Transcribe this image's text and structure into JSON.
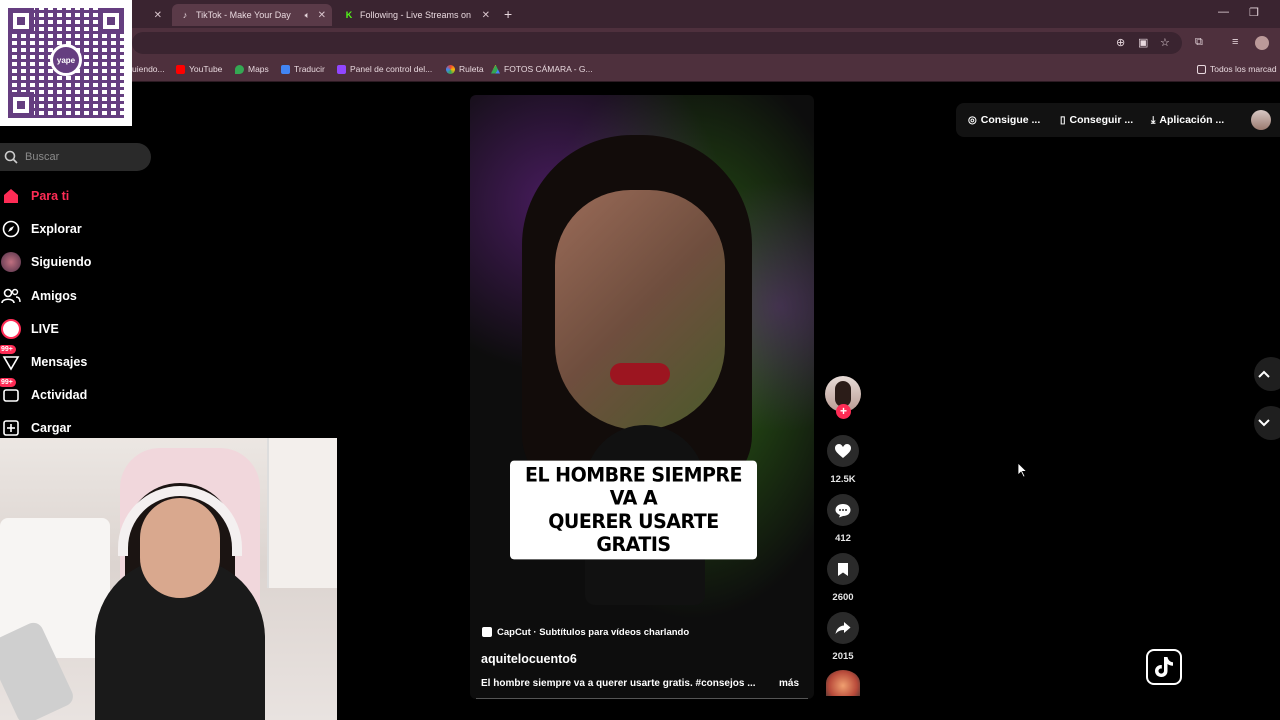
{
  "browser": {
    "tabs": [
      {
        "title": "TikTok - Make Your Day",
        "active": true,
        "icon": "tiktok-icon"
      },
      {
        "title": "Following - Live Streams on Kic",
        "active": false,
        "icon": "kick-icon"
      }
    ],
    "bookmarks": [
      {
        "label": "uiendo...",
        "color": "#888888"
      },
      {
        "label": "YouTube",
        "color": "#ff0000"
      },
      {
        "label": "Maps",
        "color": "#34a853"
      },
      {
        "label": "Traducir",
        "color": "#4285f4"
      },
      {
        "label": "Panel de control del...",
        "color": "#9146ff"
      },
      {
        "label": "Ruleta",
        "color": "#ea4335"
      },
      {
        "label": "FOTOS CÁMARA - G...",
        "color": "#fbbc04"
      }
    ],
    "all_bookmarks": "Todos los marcad"
  },
  "overlay": {
    "qr_brand": "yape"
  },
  "sidebar": {
    "search_placeholder": "Buscar",
    "items": [
      {
        "label": "Para ti",
        "icon": "home-icon",
        "active": true
      },
      {
        "label": "Explorar",
        "icon": "compass-icon"
      },
      {
        "label": "Siguiendo",
        "icon": "following-avatar-icon"
      },
      {
        "label": "Amigos",
        "icon": "friends-icon"
      },
      {
        "label": "LIVE",
        "icon": "live-icon"
      },
      {
        "label": "Mensajes",
        "icon": "messages-icon",
        "badge": "99+"
      },
      {
        "label": "Actividad",
        "icon": "activity-icon",
        "badge": "99+"
      },
      {
        "label": "Cargar",
        "icon": "upload-icon"
      }
    ]
  },
  "topbar": {
    "buttons": [
      "Consigue ...",
      "Conseguir ...",
      "Aplicación ..."
    ]
  },
  "video": {
    "caption_line1": "EL HOMBRE SIEMPRE VA A",
    "caption_line2": "QUERER USARTE GRATIS",
    "capcut": "CapCut · Subtítulos para vídeos charlando",
    "author": "aquitelocuento6",
    "description": "El hombre siempre va a querer usarte gratis. #consejos ...",
    "more": "más"
  },
  "actions": {
    "likes": "12.5K",
    "comments": "412",
    "saves": "2600",
    "shares": "2015"
  },
  "colors": {
    "accent": "#fe2c55",
    "chrome_bg": "#4e303d"
  }
}
